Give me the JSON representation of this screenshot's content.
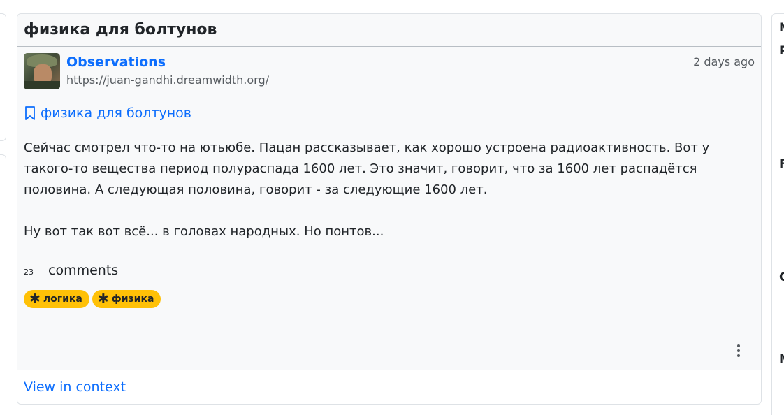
{
  "post": {
    "title": "физика для болтунов",
    "journal_name": "Observations",
    "journal_url": "https://juan-gandhi.dreamwidth.org/",
    "time_ago": "2 days ago",
    "bookmark_title": "физика для болтунов",
    "paragraphs": [
      "Сейчас смотрел что-то на ютьюбе. Пацан рассказывает, как хорошо устроена радиоактивность. Вот у такого-то вещества период полураспада 1600 лет. Это значит, говорит, что за 1600 лет распадётся половина. А следующая половина, говорит - за следующие 1600 лет.",
      "Ну вот так вот всё... в головах народных. Но понтов..."
    ],
    "comments_count": "23",
    "comments_label": "comments",
    "tags": [
      {
        "icon": "asterisk-icon",
        "label": "логика"
      },
      {
        "icon": "asterisk-icon",
        "label": "физика"
      }
    ],
    "view_in_context": "View in context"
  },
  "right_sidebar": {
    "letters": [
      "N",
      "P",
      "F",
      "C",
      "M"
    ]
  },
  "colors": {
    "link": "#0d6efd",
    "tag_bg": "#ffc107",
    "card_bg": "#f8f9fa"
  }
}
